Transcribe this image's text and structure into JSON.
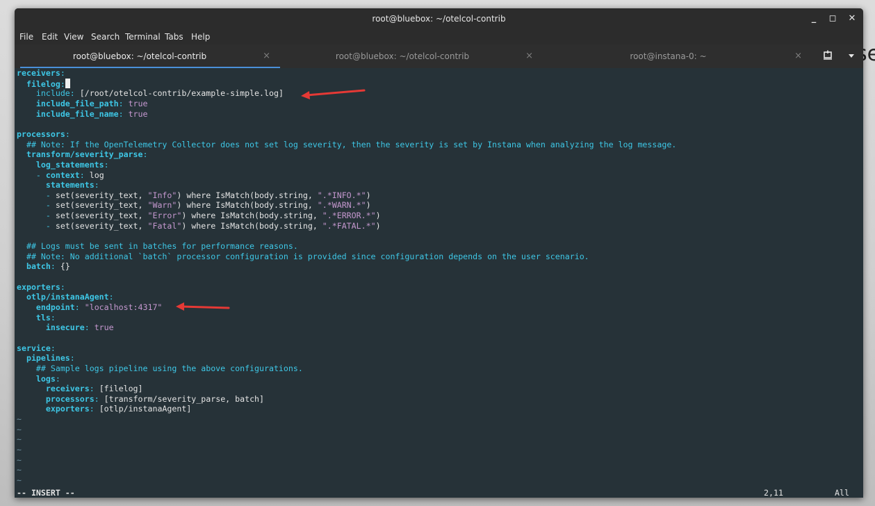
{
  "window": {
    "title": "root@bluebox: ~/otelcol-contrib",
    "minimize_glyph": "_",
    "maximize_glyph": "◻",
    "close_glyph": "✕"
  },
  "menu": [
    "File",
    "Edit",
    "View",
    "Search",
    "Terminal",
    "Tabs",
    "Help"
  ],
  "tabs": [
    {
      "label": "root@bluebox: ~/otelcol-contrib",
      "close": "×",
      "active": true
    },
    {
      "label": "root@bluebox: ~/otelcol-contrib",
      "close": "×",
      "active": false
    },
    {
      "label": "root@instana-0: ~",
      "close": "×",
      "active": false
    }
  ],
  "tab_tools": {
    "new_tab_icon": "new-tab-icon",
    "menu_icon": "chevron-down-icon"
  },
  "background_text": "se",
  "editor": {
    "lines": [
      [
        {
          "c": "k",
          "t": "receivers"
        },
        {
          "c": "p",
          "t": ":"
        }
      ],
      [
        {
          "c": "t",
          "t": "  "
        },
        {
          "c": "k",
          "t": "filelog"
        },
        {
          "c": "p",
          "t": ":"
        },
        {
          "c": "cursor",
          "t": ""
        }
      ],
      [
        {
          "c": "t",
          "t": "    "
        },
        {
          "c": "p",
          "t": "include"
        },
        {
          "c": "p",
          "t": ": "
        },
        {
          "c": "t",
          "t": "[/root/otelcol-contrib/example-simple.log]"
        }
      ],
      [
        {
          "c": "t",
          "t": "    "
        },
        {
          "c": "k",
          "t": "include_file_path"
        },
        {
          "c": "p",
          "t": ": "
        },
        {
          "c": "s",
          "t": "true"
        }
      ],
      [
        {
          "c": "t",
          "t": "    "
        },
        {
          "c": "k",
          "t": "include_file_name"
        },
        {
          "c": "p",
          "t": ": "
        },
        {
          "c": "s",
          "t": "true"
        }
      ],
      [],
      [
        {
          "c": "k",
          "t": "processors"
        },
        {
          "c": "p",
          "t": ":"
        }
      ],
      [
        {
          "c": "t",
          "t": "  "
        },
        {
          "c": "c",
          "t": "## Note: If the OpenTelemetry Collector does not set log severity, then the severity is set by Instana when analyzing the log message."
        }
      ],
      [
        {
          "c": "t",
          "t": "  "
        },
        {
          "c": "k",
          "t": "transform/severity_parse"
        },
        {
          "c": "p",
          "t": ":"
        }
      ],
      [
        {
          "c": "t",
          "t": "    "
        },
        {
          "c": "k",
          "t": "log_statements"
        },
        {
          "c": "p",
          "t": ":"
        }
      ],
      [
        {
          "c": "t",
          "t": "    "
        },
        {
          "c": "p",
          "t": "- "
        },
        {
          "c": "k",
          "t": "context"
        },
        {
          "c": "p",
          "t": ": "
        },
        {
          "c": "t",
          "t": "log"
        }
      ],
      [
        {
          "c": "t",
          "t": "      "
        },
        {
          "c": "k",
          "t": "statements"
        },
        {
          "c": "p",
          "t": ":"
        }
      ],
      [
        {
          "c": "t",
          "t": "      "
        },
        {
          "c": "p",
          "t": "- "
        },
        {
          "c": "t",
          "t": "set(severity_text, "
        },
        {
          "c": "s",
          "t": "\"Info\""
        },
        {
          "c": "t",
          "t": ") where IsMatch(body.string, "
        },
        {
          "c": "s",
          "t": "\".*INFO.*\""
        },
        {
          "c": "t",
          "t": ")"
        }
      ],
      [
        {
          "c": "t",
          "t": "      "
        },
        {
          "c": "p",
          "t": "- "
        },
        {
          "c": "t",
          "t": "set(severity_text, "
        },
        {
          "c": "s",
          "t": "\"Warn\""
        },
        {
          "c": "t",
          "t": ") where IsMatch(body.string, "
        },
        {
          "c": "s",
          "t": "\".*WARN.*\""
        },
        {
          "c": "t",
          "t": ")"
        }
      ],
      [
        {
          "c": "t",
          "t": "      "
        },
        {
          "c": "p",
          "t": "- "
        },
        {
          "c": "t",
          "t": "set(severity_text, "
        },
        {
          "c": "s",
          "t": "\"Error\""
        },
        {
          "c": "t",
          "t": ") where IsMatch(body.string, "
        },
        {
          "c": "s",
          "t": "\".*ERROR.*\""
        },
        {
          "c": "t",
          "t": ")"
        }
      ],
      [
        {
          "c": "t",
          "t": "      "
        },
        {
          "c": "p",
          "t": "- "
        },
        {
          "c": "t",
          "t": "set(severity_text, "
        },
        {
          "c": "s",
          "t": "\"Fatal\""
        },
        {
          "c": "t",
          "t": ") where IsMatch(body.string, "
        },
        {
          "c": "s",
          "t": "\".*FATAL.*\""
        },
        {
          "c": "t",
          "t": ")"
        }
      ],
      [],
      [
        {
          "c": "t",
          "t": "  "
        },
        {
          "c": "c",
          "t": "## Logs must be sent in batches for performance reasons."
        }
      ],
      [
        {
          "c": "t",
          "t": "  "
        },
        {
          "c": "c",
          "t": "## Note: No additional `batch` processor configuration is provided since configuration depends on the user scenario."
        }
      ],
      [
        {
          "c": "t",
          "t": "  "
        },
        {
          "c": "k",
          "t": "batch"
        },
        {
          "c": "p",
          "t": ": "
        },
        {
          "c": "t",
          "t": "{}"
        }
      ],
      [],
      [
        {
          "c": "k",
          "t": "exporters"
        },
        {
          "c": "p",
          "t": ":"
        }
      ],
      [
        {
          "c": "t",
          "t": "  "
        },
        {
          "c": "k",
          "t": "otlp/instanaAgent"
        },
        {
          "c": "p",
          "t": ":"
        }
      ],
      [
        {
          "c": "t",
          "t": "    "
        },
        {
          "c": "k",
          "t": "endpoint"
        },
        {
          "c": "p",
          "t": ": "
        },
        {
          "c": "s",
          "t": "\"localhost:4317\""
        }
      ],
      [
        {
          "c": "t",
          "t": "    "
        },
        {
          "c": "k",
          "t": "tls"
        },
        {
          "c": "p",
          "t": ":"
        }
      ],
      [
        {
          "c": "t",
          "t": "      "
        },
        {
          "c": "k",
          "t": "insecure"
        },
        {
          "c": "p",
          "t": ": "
        },
        {
          "c": "s",
          "t": "true"
        }
      ],
      [],
      [
        {
          "c": "k",
          "t": "service"
        },
        {
          "c": "p",
          "t": ":"
        }
      ],
      [
        {
          "c": "t",
          "t": "  "
        },
        {
          "c": "k",
          "t": "pipelines"
        },
        {
          "c": "p",
          "t": ":"
        }
      ],
      [
        {
          "c": "t",
          "t": "    "
        },
        {
          "c": "c",
          "t": "## Sample logs pipeline using the above configurations."
        }
      ],
      [
        {
          "c": "t",
          "t": "    "
        },
        {
          "c": "k",
          "t": "logs"
        },
        {
          "c": "p",
          "t": ":"
        }
      ],
      [
        {
          "c": "t",
          "t": "      "
        },
        {
          "c": "k",
          "t": "receivers"
        },
        {
          "c": "p",
          "t": ": "
        },
        {
          "c": "t",
          "t": "[filelog]"
        }
      ],
      [
        {
          "c": "t",
          "t": "      "
        },
        {
          "c": "k",
          "t": "processors"
        },
        {
          "c": "p",
          "t": ": "
        },
        {
          "c": "t",
          "t": "[transform/severity_parse, batch]"
        }
      ],
      [
        {
          "c": "t",
          "t": "      "
        },
        {
          "c": "k",
          "t": "exporters"
        },
        {
          "c": "p",
          "t": ": "
        },
        {
          "c": "t",
          "t": "[otlp/instanaAgent]"
        }
      ],
      [
        {
          "c": "tilde",
          "t": "~"
        }
      ],
      [
        {
          "c": "tilde",
          "t": "~"
        }
      ],
      [
        {
          "c": "tilde",
          "t": "~"
        }
      ],
      [
        {
          "c": "tilde",
          "t": "~"
        }
      ],
      [
        {
          "c": "tilde",
          "t": "~"
        }
      ],
      [
        {
          "c": "tilde",
          "t": "~"
        }
      ],
      [
        {
          "c": "tilde",
          "t": "~"
        }
      ]
    ],
    "mode": "-- INSERT --",
    "position": "2,11",
    "scroll": "All"
  },
  "annotation_colors": {
    "arrow": "#e53935"
  }
}
